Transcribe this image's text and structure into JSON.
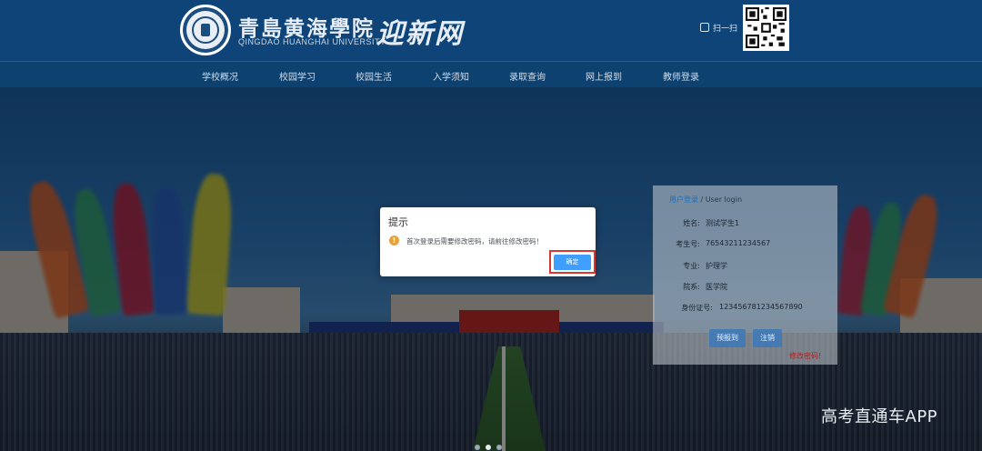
{
  "header": {
    "school_name": "青島黄海學院",
    "school_name_en": "QINGDAO HUANGHAI UNIVERSITY",
    "site_name": "迎新网",
    "scan_label": "扫一扫",
    "scan_icon": "qr-scan-icon"
  },
  "nav": {
    "items": [
      "学校概况",
      "校园学习",
      "校园生活",
      "入学须知",
      "录取查询",
      "网上报到",
      "教师登录"
    ]
  },
  "login_panel": {
    "title_accent": "用户登录",
    "title_rest": " / User login",
    "fields": [
      {
        "label": "姓名:",
        "value": "测试学生1"
      },
      {
        "label": "考生号:",
        "value": "76543211234567"
      },
      {
        "label": "专业:",
        "value": "护理学"
      },
      {
        "label": "院系:",
        "value": "医学院"
      },
      {
        "label": "身份证号:",
        "value": "123456781234567890"
      }
    ],
    "pre_register_label": "预报到",
    "logout_label": "注销",
    "change_password_label": "修改密码!"
  },
  "dialog": {
    "title": "提示",
    "message": "首次登录后需要修改密码，请前往修改密码！",
    "confirm_label": "确定",
    "icon": "warning-icon"
  },
  "carousel": {
    "active_index": 1,
    "count": 3
  },
  "watermark": "高考直通车APP",
  "colors": {
    "header_bg": "#0e4478",
    "accent_blue": "#409eff",
    "warning": "#e6a23c",
    "highlight_red": "#d9362f"
  }
}
